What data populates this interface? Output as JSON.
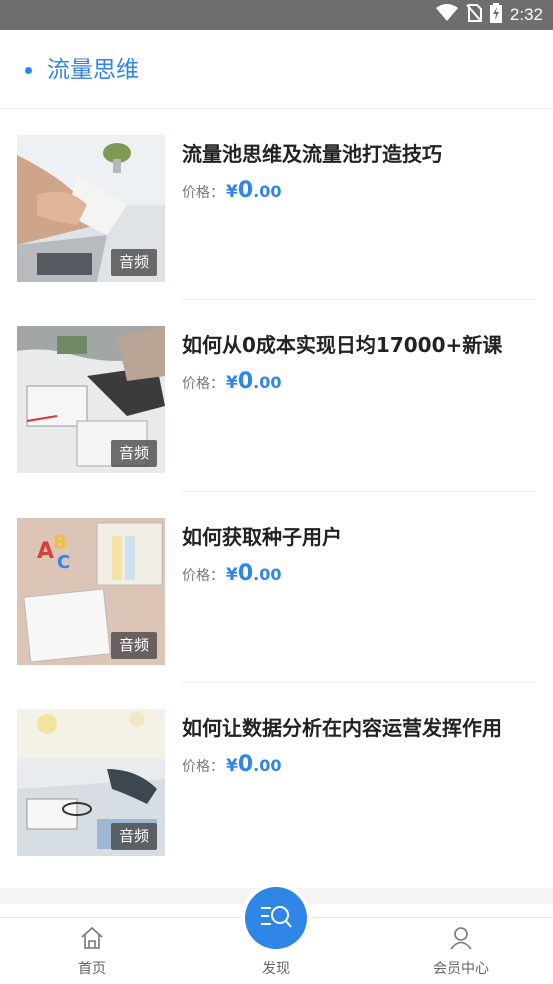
{
  "status_bar": {
    "time": "2:32"
  },
  "header": {
    "title": "流量思维"
  },
  "items": [
    {
      "title": "流量池思维及流量池打造技巧",
      "price_label": "价格：",
      "currency": "¥",
      "price_int": "0",
      "price_dec": ".00",
      "badge": "音频"
    },
    {
      "title": "如何从0成本实现日均17000+新课",
      "price_label": "价格：",
      "currency": "¥",
      "price_int": "0",
      "price_dec": ".00",
      "badge": "音频"
    },
    {
      "title": "如何获取种子用户",
      "price_label": "价格：",
      "currency": "¥",
      "price_int": "0",
      "price_dec": ".00",
      "badge": "音频"
    },
    {
      "title": "如何让数据分析在内容运营发挥作用",
      "price_label": "价格：",
      "currency": "¥",
      "price_int": "0",
      "price_dec": ".00",
      "badge": "音频"
    }
  ],
  "tabbar": {
    "home_label": "首页",
    "discover_label": "发现",
    "member_label": "会员中心"
  },
  "colors": {
    "accent": "#2f86e6",
    "status_bar": "#6e6e6e"
  },
  "icons": [
    "wifi-icon",
    "no-sim-icon",
    "battery-charging-icon",
    "home-icon",
    "discover-search-icon",
    "user-icon"
  ]
}
